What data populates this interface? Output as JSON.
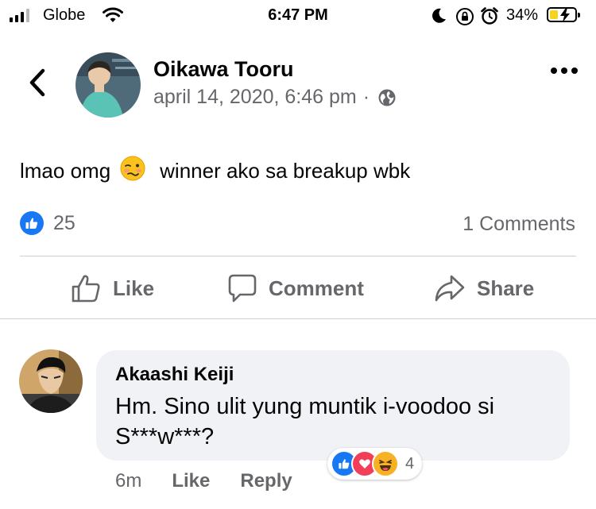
{
  "status_bar": {
    "carrier": "Globe",
    "time": "6:47 PM",
    "battery_percent": "34%",
    "battery_level": 0.34,
    "icons": [
      "signal-icon",
      "wifi-icon",
      "moon-icon",
      "rotation-lock-icon",
      "alarm-icon",
      "battery-icon"
    ]
  },
  "header": {
    "back_icon": "chevron-left-icon",
    "author": "Oikawa Tooru",
    "timestamp": "april 14, 2020, 6:46 pm",
    "separator": "·",
    "privacy_icon": "globe-icon",
    "more_icon": "more-horizontal-icon"
  },
  "post": {
    "text_before": "lmao omg",
    "emoji": "woozy-face-emoji",
    "text_after": "winner ako sa breakup wbk",
    "reaction_icon": "like-reaction-icon",
    "reaction_count": "25",
    "comments_count": "1 Comments"
  },
  "actions": {
    "like": "Like",
    "comment": "Comment",
    "share": "Share"
  },
  "comment": {
    "author": "Akaashi Keiji",
    "text": "Hm. Sino ulit yung muntik i-voodoo si S***w***?",
    "reactions": [
      "like-reaction-icon",
      "love-reaction-icon",
      "haha-reaction-icon"
    ],
    "reaction_count": "4",
    "time": "6m",
    "like": "Like",
    "reply": "Reply"
  },
  "colors": {
    "facebook_blue": "#1877f2",
    "love_red": "#f33e58",
    "haha_yellow": "#f7b125",
    "secondary_text": "#65676b",
    "bubble_bg": "#f0f2f5",
    "battery_fill": "#f7d21e"
  }
}
